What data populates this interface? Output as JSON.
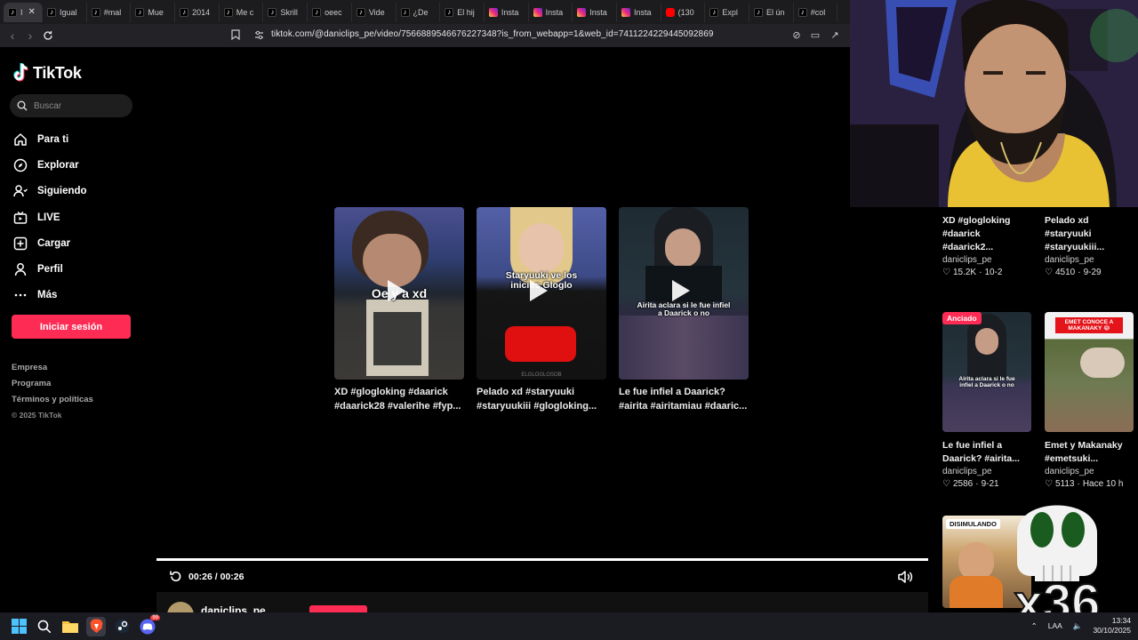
{
  "browser": {
    "tabs": [
      {
        "label": "I",
        "favicon": "tiktok-icon",
        "active": true
      },
      {
        "label": "Igual",
        "favicon": "tiktok-icon"
      },
      {
        "label": "#mal",
        "favicon": "tiktok-icon"
      },
      {
        "label": "Mue",
        "favicon": "tiktok-icon"
      },
      {
        "label": "2014",
        "favicon": "tiktok-icon"
      },
      {
        "label": "Me c",
        "favicon": "tiktok-icon"
      },
      {
        "label": "Skrill",
        "favicon": "tiktok-icon"
      },
      {
        "label": "oeec",
        "favicon": "tiktok-icon"
      },
      {
        "label": "Vide",
        "favicon": "tiktok-icon"
      },
      {
        "label": "¿De",
        "favicon": "tiktok-icon"
      },
      {
        "label": "El hij",
        "favicon": "tiktok-icon"
      },
      {
        "label": "Insta",
        "favicon": "instagram-icon"
      },
      {
        "label": "Insta",
        "favicon": "instagram-icon"
      },
      {
        "label": "Insta",
        "favicon": "instagram-icon"
      },
      {
        "label": "Insta",
        "favicon": "instagram-icon"
      },
      {
        "label": "(130",
        "favicon": "youtube-icon"
      },
      {
        "label": "Expl",
        "favicon": "tiktok-icon"
      },
      {
        "label": "El ún",
        "favicon": "tiktok-icon"
      },
      {
        "label": "#col",
        "favicon": "tiktok-icon"
      }
    ],
    "url": "tiktok.com/@daniclips_pe/video/7566889546676227348?is_from_webapp=1&web_id=7411224229445092869"
  },
  "sidebar": {
    "brand": "TikTok",
    "search_placeholder": "Buscar",
    "nav": [
      {
        "label": "Para ti",
        "icon": "home-icon"
      },
      {
        "label": "Explorar",
        "icon": "compass-icon"
      },
      {
        "label": "Siguiendo",
        "icon": "following-icon"
      },
      {
        "label": "LIVE",
        "icon": "live-icon"
      },
      {
        "label": "Cargar",
        "icon": "upload-icon"
      },
      {
        "label": "Perfil",
        "icon": "profile-icon"
      },
      {
        "label": "Más",
        "icon": "more-icon"
      }
    ],
    "login_label": "Iniciar sesión",
    "footer": [
      "Empresa",
      "Programa",
      "Términos y políticas"
    ],
    "copyright": "© 2025 TikTok"
  },
  "player": {
    "related": [
      {
        "title": "XD #glogloking #daarick #daarick28 #valerihe #fyp...",
        "overlay": "Oe y a xd"
      },
      {
        "title": "Pelado xd #staryuuki #staryuukiii #glogloking...",
        "overlay": "Staryuuki ve los inicios  Gloglo",
        "watermark": "ELGLOGLOSOB"
      },
      {
        "title": "Le fue infiel a Daarick? #airita #airitamiau #daaric...",
        "overlay": "Airita aclara si le fue infiel a Daarick o no"
      }
    ],
    "time": "00:26 / 00:26",
    "author": "daniclips_pe"
  },
  "recommended": [
    {
      "title": "XD #glogloking #daarick #daarick2...",
      "author": "daniclips_pe",
      "likes": "15.2K",
      "date": "10-2"
    },
    {
      "title": "Pelado xd #staryuuki #staryuukiii...",
      "author": "daniclips_pe",
      "likes": "4510",
      "date": "9-29"
    },
    {
      "title": "Le fue infiel a Daarick? #airita...",
      "author": "daniclips_pe",
      "likes": "2586",
      "date": "9-21",
      "badge": "Anciado",
      "overlay": "Airita aclara si le fue infiel a Daarick o no"
    },
    {
      "title": "Emet y Makanaky #emetsuki...",
      "author": "daniclips_pe",
      "likes": "5113",
      "date": "Hace 10 h",
      "overlay": "EMET CONOCE A MAKANAKY 😂"
    },
    {
      "overlay": "DISIMULANDO"
    }
  ],
  "overlay_logo_text": "x36",
  "taskbar": {
    "language": "LAA",
    "time": "13:34",
    "date": "30/10/2025",
    "notification_count": "99"
  },
  "colors": {
    "accent": "#fe2c55",
    "background": "#000000"
  }
}
